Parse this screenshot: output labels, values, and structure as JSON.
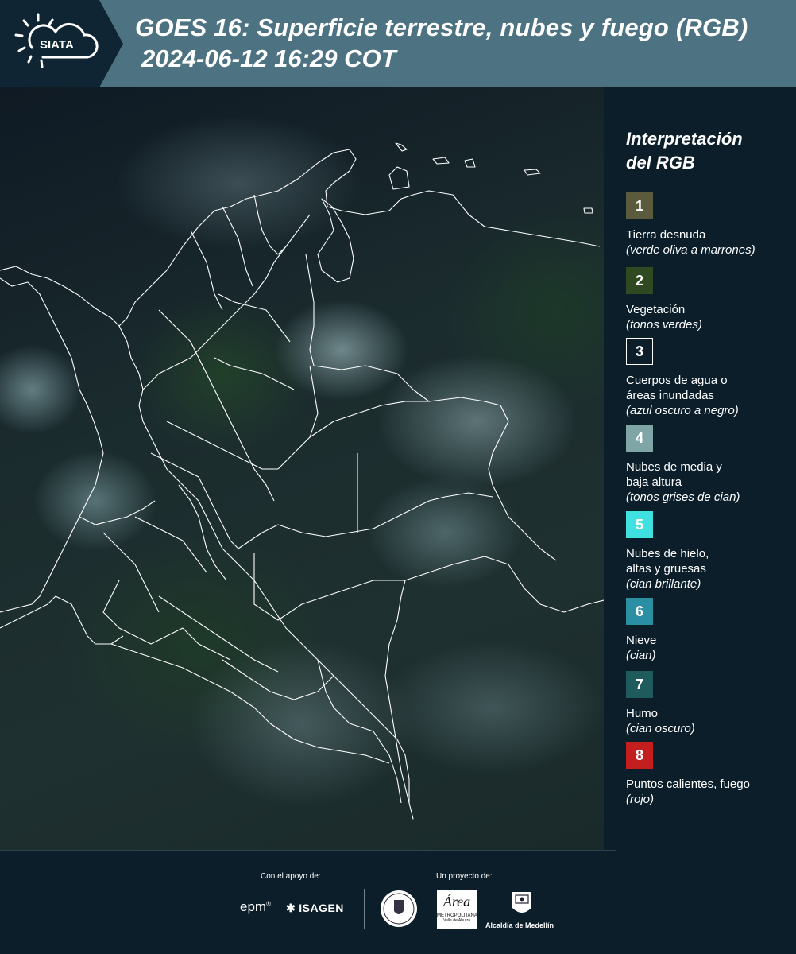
{
  "header": {
    "logo_text": "SIATA",
    "title": "GOES 16: Superficie terrestre, nubes y fuego (RGB)",
    "datetime": "2024-06-12 16:29 COT"
  },
  "legend": {
    "title_line1": "Interpretación",
    "title_line2": "del RGB",
    "items": [
      {
        "num": "1",
        "color": "#5c5a3c",
        "label": "Tierra desnuda",
        "note": "(verde oliva a marrones)"
      },
      {
        "num": "2",
        "color": "#2f4a20",
        "label": "Vegetación",
        "note": "(tonos verdes)"
      },
      {
        "num": "3",
        "color": "#0b1e2a",
        "label": "Cuerpos de agua o áreas inundadas",
        "note": "(azul oscuro a negro)"
      },
      {
        "num": "4",
        "color": "#7fa5a7",
        "label": "Nubes de media y baja altura",
        "note": "(tonos grises de cian)"
      },
      {
        "num": "5",
        "color": "#3ee0e0",
        "label": "Nubes de hielo, altas y gruesas",
        "note": "(cian brillante)"
      },
      {
        "num": "6",
        "color": "#2a8fa3",
        "label": "Nieve",
        "note": "(cian)"
      },
      {
        "num": "7",
        "color": "#1f5a5c",
        "label": "Humo",
        "note": "(cian oscuro)"
      },
      {
        "num": "8",
        "color": "#c41e1e",
        "label": "Puntos calientes, fuego",
        "note": "(rojo)"
      }
    ]
  },
  "footer": {
    "support_label": "Con el apoyo de:",
    "project_label": "Un proyecto de:",
    "sponsor_epm": "epm",
    "sponsor_isagen": "ISAGEN",
    "area_logo_word": "Área",
    "area_logo_sub": "METROPOLITANA",
    "area_logo_sub2": "Valle de Aburrá",
    "medellin": "Alcaldía de Medellín"
  }
}
